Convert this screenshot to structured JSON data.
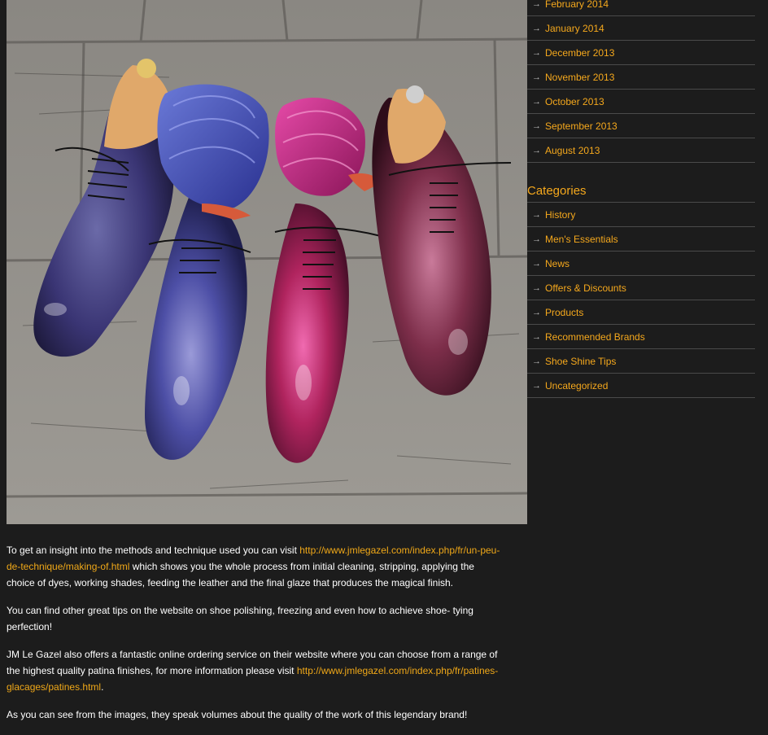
{
  "sidebar": {
    "archives": [
      {
        "label": "February 2014"
      },
      {
        "label": "January 2014"
      },
      {
        "label": "December 2013"
      },
      {
        "label": "November 2013"
      },
      {
        "label": "October 2013"
      },
      {
        "label": "September 2013"
      },
      {
        "label": "August 2013"
      }
    ],
    "categories_title": "Categories",
    "categories": [
      {
        "label": "History"
      },
      {
        "label": "Men's Essentials"
      },
      {
        "label": "News"
      },
      {
        "label": "Offers & Discounts"
      },
      {
        "label": "Products"
      },
      {
        "label": "Recommended Brands"
      },
      {
        "label": "Shoe Shine Tips"
      },
      {
        "label": "Uncategorized"
      }
    ],
    "arrow_glyph": "→"
  },
  "photo": {
    "icon": "shoes-photo"
  },
  "article": {
    "p1_before": "To get an insight into the methods and technique used you can visit ",
    "p1_link": "http://www.jmlegazel.com/index.php/fr/un-peu-de-technique/making-of.html",
    "p1_after": " which shows you the whole process from initial cleaning, stripping, applying the choice of dyes, working shades, feeding the leather and the final glaze that produces the magical finish.",
    "p2": "You can find other great tips on the website on shoe polishing, freezing and even how to achieve shoe- tying perfection!",
    "p3_before": "JM Le Gazel also offers a fantastic online ordering service on their website where you can choose from a range of the highest quality patina finishes, for more information please visit ",
    "p3_link": "http://www.jmlegazel.com/index.php/fr/patines-glacages/patines.html",
    "p3_after": ".",
    "p4": "As you can see from the images, they speak volumes about the quality of the work of this legendary brand!"
  },
  "colors": {
    "background": "#1c1c1c",
    "accent": "#f5a81c",
    "link": "#f0a818",
    "divider": "#4a4a4a"
  }
}
